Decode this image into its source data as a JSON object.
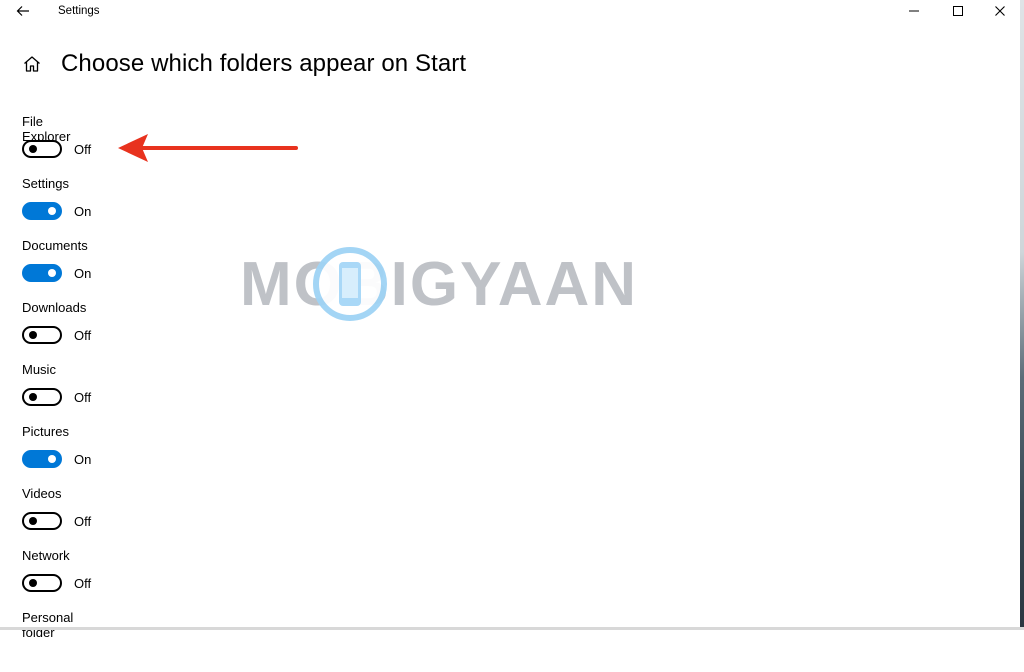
{
  "window": {
    "title": "Settings"
  },
  "page": {
    "title": "Choose which folders appear on Start"
  },
  "folders": [
    {
      "label": "File Explorer",
      "state": "Off",
      "on": false
    },
    {
      "label": "Settings",
      "state": "On",
      "on": true
    },
    {
      "label": "Documents",
      "state": "On",
      "on": true
    },
    {
      "label": "Downloads",
      "state": "Off",
      "on": false
    },
    {
      "label": "Music",
      "state": "Off",
      "on": false
    },
    {
      "label": "Pictures",
      "state": "On",
      "on": true
    },
    {
      "label": "Videos",
      "state": "Off",
      "on": false
    },
    {
      "label": "Network",
      "state": "Off",
      "on": false
    },
    {
      "label": "Personal folder"
    }
  ],
  "watermark": {
    "text": "MOBIGYAAN"
  },
  "colors": {
    "accent": "#0078d7",
    "annotation_arrow": "#e8321e"
  },
  "icons": {
    "back": "arrow-left-icon",
    "home": "home-icon",
    "minimize": "minimize-icon",
    "maximize": "maximize-icon",
    "close": "close-icon"
  }
}
